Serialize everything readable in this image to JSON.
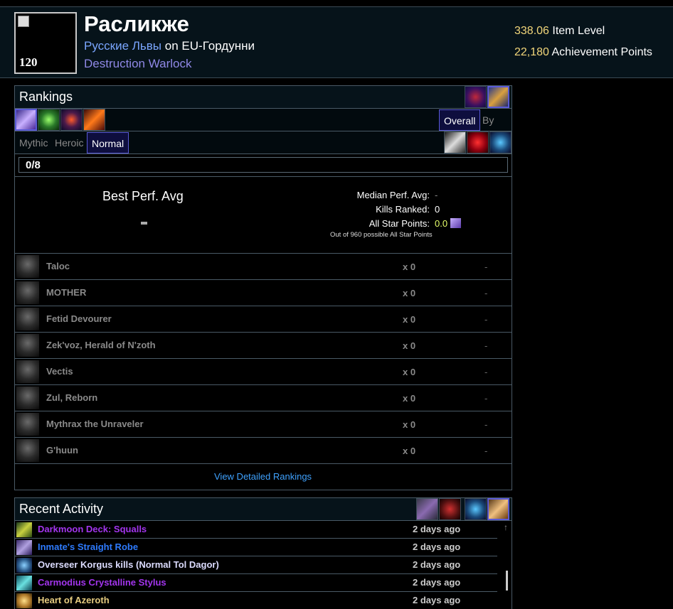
{
  "character": {
    "level": "120",
    "name": "Расликже",
    "guild": "Русские Львы",
    "on_word": "on",
    "realm": "EU-Гордунни",
    "spec": "Destruction Warlock",
    "item_level_value": "338.06",
    "item_level_label": "Item Level",
    "achievement_value": "22,180",
    "achievement_label": "Achievement Points"
  },
  "rankings": {
    "title": "Rankings",
    "difficulty_tabs": [
      "Mythic",
      "Heroic",
      "Normal"
    ],
    "active_difficulty": "Normal",
    "metric_tabs": [
      "Overall",
      "By Ilvl"
    ],
    "active_metric": "Overall",
    "progress": "0/8",
    "best_perf_label": "Best Perf. Avg",
    "median_label": "Median Perf. Avg:",
    "median_value": "-",
    "kills_label": "Kills Ranked:",
    "kills_value": "0",
    "star_label": "All Star Points:",
    "star_value": "0.0",
    "star_note": "Out of 960 possible All Star Points",
    "bosses": [
      {
        "name": "Taloc",
        "kills": "x 0",
        "perf": "-"
      },
      {
        "name": "MOTHER",
        "kills": "x 0",
        "perf": "-"
      },
      {
        "name": "Fetid Devourer",
        "kills": "x 0",
        "perf": "-"
      },
      {
        "name": "Zek'voz, Herald of N'zoth",
        "kills": "x 0",
        "perf": "-"
      },
      {
        "name": "Vectis",
        "kills": "x 0",
        "perf": "-"
      },
      {
        "name": "Zul, Reborn",
        "kills": "x 0",
        "perf": "-"
      },
      {
        "name": "Mythrax the Unraveler",
        "kills": "x 0",
        "perf": "-"
      },
      {
        "name": "G'huun",
        "kills": "x 0",
        "perf": "-"
      }
    ],
    "view_link": "View Detailed Rankings"
  },
  "activity": {
    "title": "Recent Activity",
    "items": [
      {
        "text": "Darkmoon Deck: Squalls",
        "time": "2 days ago",
        "color": "#a335ee"
      },
      {
        "text": "Inmate's Straight Robe",
        "time": "2 days ago",
        "color": "#2e7bff"
      },
      {
        "text": "Overseer Korgus kills (Normal Tol Dagor)",
        "time": "2 days ago",
        "color": "#dcdcff"
      },
      {
        "text": "Carmodius Crystalline Stylus",
        "time": "2 days ago",
        "color": "#a335ee"
      },
      {
        "text": "Heart of Azeroth",
        "time": "2 days ago",
        "color": "#e6cc80"
      }
    ]
  }
}
